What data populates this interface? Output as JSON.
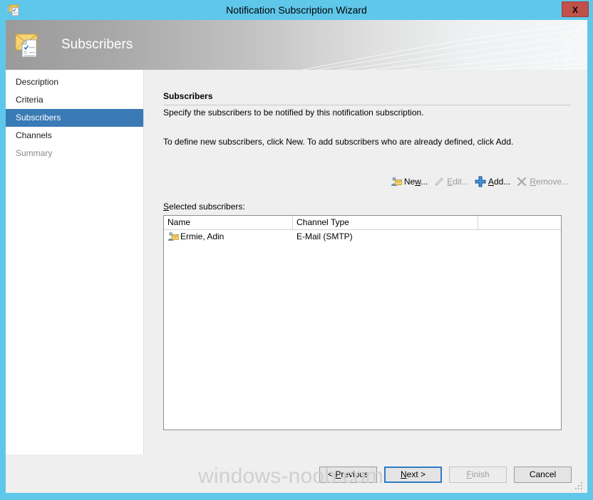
{
  "window": {
    "title": "Notification Subscription Wizard",
    "close_label": "X",
    "titlebar_color": "#5fc7ea",
    "accent_color": "#3a7ab5"
  },
  "banner": {
    "title": "Subscribers",
    "icon": "envelope-checklist-icon"
  },
  "sidebar": {
    "items": [
      {
        "label": "Description",
        "state": "normal"
      },
      {
        "label": "Criteria",
        "state": "normal"
      },
      {
        "label": "Subscribers",
        "state": "selected"
      },
      {
        "label": "Channels",
        "state": "normal"
      },
      {
        "label": "Summary",
        "state": "disabled"
      }
    ]
  },
  "main": {
    "section_title": "Subscribers",
    "description_line1": "Specify the subscribers to be notified by this notification subscription.",
    "description_line2": "To define new subscribers, click New.  To add subscribers who are already defined, click Add.",
    "list_label": "Selected subscribers:",
    "list_label_accesskey": "S"
  },
  "toolbar": {
    "buttons": [
      {
        "label": "New...",
        "accesskey": "w",
        "icon": "user-mail-new-icon",
        "enabled": true
      },
      {
        "label": "Edit...",
        "accesskey": "E",
        "icon": "pencil-icon",
        "enabled": false
      },
      {
        "label": "Add...",
        "accesskey": "A",
        "icon": "blue-plus-icon",
        "enabled": true
      },
      {
        "label": "Remove...",
        "accesskey": "R",
        "icon": "gray-x-icon",
        "enabled": false
      }
    ]
  },
  "listview": {
    "columns": [
      "Name",
      "Channel Type",
      ""
    ],
    "rows": [
      {
        "name": "Ermie, Adin",
        "channel_type": "E-Mail (SMTP)",
        "icon": "user-mail-icon"
      }
    ]
  },
  "footer": {
    "buttons": [
      {
        "label": "< Previous",
        "accesskey": "P",
        "enabled": true,
        "default": false
      },
      {
        "label": "Next >",
        "accesskey": "N",
        "enabled": true,
        "default": true
      },
      {
        "label": "Finish",
        "accesskey": "F",
        "enabled": false,
        "default": false
      },
      {
        "label": "Cancel",
        "accesskey": "",
        "enabled": true,
        "default": false
      }
    ],
    "watermark": "windows-noob.com"
  }
}
